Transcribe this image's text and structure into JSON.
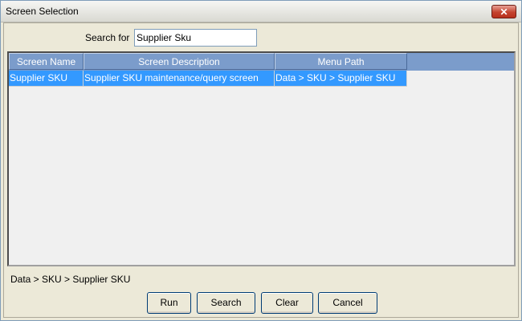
{
  "window": {
    "title": "Screen Selection",
    "close_glyph": "✕"
  },
  "search": {
    "label": "Search for",
    "value": "Supplier Sku"
  },
  "grid": {
    "columns": [
      "Screen Name",
      "Screen Description",
      "Menu Path"
    ],
    "rows": [
      {
        "screen_name": "Supplier SKU",
        "description": "Supplier SKU maintenance/query screen",
        "menu_path": "Data > SKU > Supplier SKU",
        "selected": true
      }
    ],
    "header_color": "#7b9ccb",
    "selected_row_color": "#3399ff"
  },
  "status": {
    "text": "Data > SKU > Supplier SKU"
  },
  "buttons": {
    "run": "Run",
    "search": "Search",
    "clear": "Clear",
    "cancel": "Cancel"
  }
}
